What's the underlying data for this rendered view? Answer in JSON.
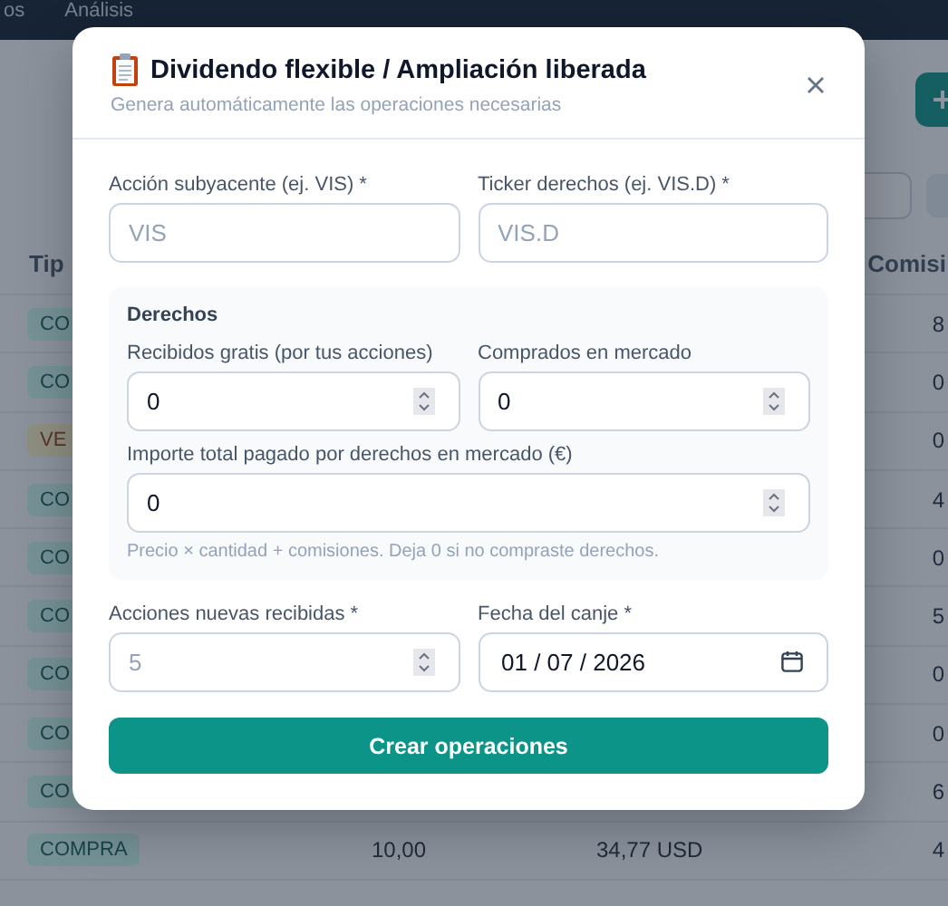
{
  "nav": {
    "items": [
      {
        "label": "os"
      },
      {
        "label": "Análisis"
      }
    ]
  },
  "table": {
    "columns": [
      "Tip",
      "Comisi"
    ],
    "rows": [
      {
        "kind": "buy",
        "type": "CO",
        "commission": "8"
      },
      {
        "kind": "buy",
        "type": "CO",
        "commission": "0"
      },
      {
        "kind": "sell",
        "type": "VE",
        "commission": "0"
      },
      {
        "kind": "buy",
        "type": "CO",
        "commission": "4"
      },
      {
        "kind": "buy",
        "type": "CO",
        "commission": "0"
      },
      {
        "kind": "buy",
        "type": "CO",
        "commission": "5"
      },
      {
        "kind": "buy",
        "type": "CO",
        "commission": "0"
      },
      {
        "kind": "buy",
        "type": "CO",
        "commission": "0"
      },
      {
        "kind": "buy",
        "type": "CO",
        "commission": "6"
      },
      {
        "kind": "buy",
        "type": "COMPRA",
        "quantity": "10,00",
        "price": "34,77 USD",
        "commission": "4"
      }
    ]
  },
  "modal": {
    "title": "Dividendo flexible / Ampliación liberada",
    "subtitle": "Genera automáticamente las operaciones necesarias",
    "fields_top": [
      {
        "label": "Acción subyacente (ej. VIS) *",
        "placeholder": "VIS"
      },
      {
        "label": "Ticker derechos (ej. VIS.D) *",
        "placeholder": "VIS.D"
      }
    ],
    "rights": {
      "title": "Derechos",
      "fields": [
        {
          "label": "Recibidos gratis (por tus acciones)",
          "value": "0"
        },
        {
          "label": "Comprados en mercado",
          "value": "0"
        }
      ],
      "amount": {
        "label": "Importe total pagado por derechos en mercado (€)",
        "value": "0"
      },
      "hint": "Precio × cantidad + comisiones. Deja 0 si no compraste derechos."
    },
    "new_shares": {
      "label": "Acciones nuevas recibidas *",
      "placeholder": "5"
    },
    "date": {
      "label": "Fecha del canje *",
      "value": "01 / 07 / 2026"
    },
    "submit": "Crear operaciones"
  }
}
